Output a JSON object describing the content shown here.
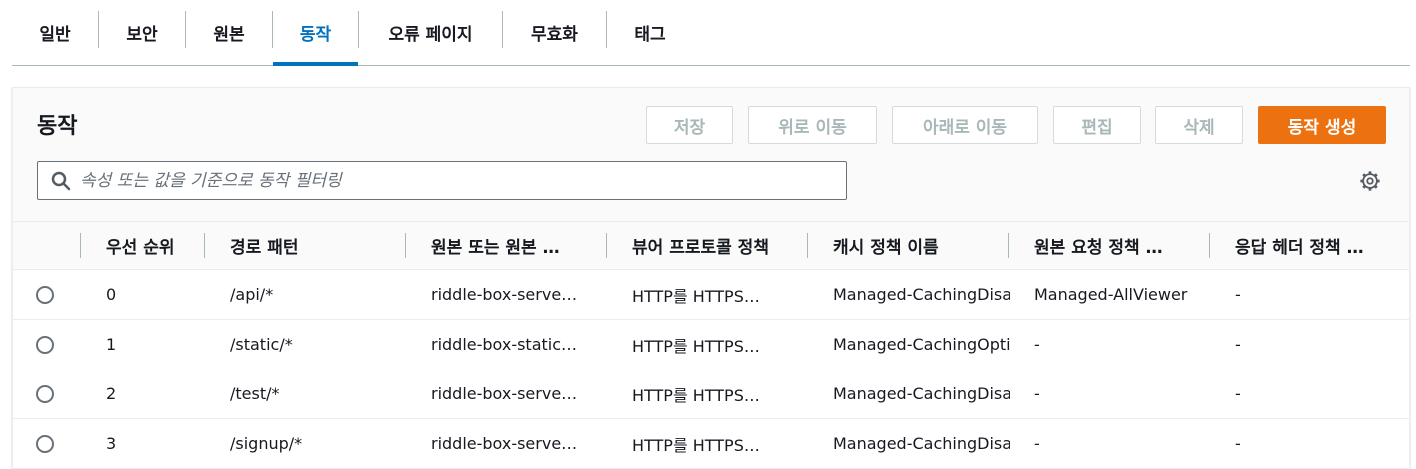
{
  "tabs": [
    {
      "label": "일반"
    },
    {
      "label": "보안"
    },
    {
      "label": "원본"
    },
    {
      "label": "동작"
    },
    {
      "label": "오류 페이지"
    },
    {
      "label": "무효화"
    },
    {
      "label": "태그"
    }
  ],
  "active_tab": "동작",
  "panel": {
    "title": "동작",
    "buttons": {
      "save": "저장",
      "move_up": "위로 이동",
      "move_down": "아래로 이동",
      "edit": "편집",
      "delete": "삭제",
      "create": "동작 생성"
    },
    "search_placeholder": "속성 또는 값을 기준으로 동작 필터링"
  },
  "table": {
    "columns": [
      "우선 순위",
      "경로 패턴",
      "원본 또는 원본 …",
      "뷰어 프로토콜 정책",
      "캐시 정책 이름",
      "원본 요청 정책 …",
      "응답 헤더 정책 …"
    ],
    "rows": [
      {
        "priority": "0",
        "path": "/api/*",
        "origin": "riddle-box-serve…",
        "viewer": "HTTP를 HTTPS…",
        "cache": "Managed-CachingDisa",
        "origin_request": "Managed-AllViewer",
        "response_headers": "-"
      },
      {
        "priority": "1",
        "path": "/static/*",
        "origin": "riddle-box-static…",
        "viewer": "HTTP를 HTTPS…",
        "cache": "Managed-CachingOpti",
        "origin_request": "-",
        "response_headers": "-"
      },
      {
        "priority": "2",
        "path": "/test/*",
        "origin": "riddle-box-serve…",
        "viewer": "HTTP를 HTTPS…",
        "cache": "Managed-CachingDisa",
        "origin_request": "-",
        "response_headers": "-"
      },
      {
        "priority": "3",
        "path": "/signup/*",
        "origin": "riddle-box-serve…",
        "viewer": "HTTP를 HTTPS…",
        "cache": "Managed-CachingDisa",
        "origin_request": "-",
        "response_headers": "-"
      }
    ]
  },
  "colors": {
    "accent": "#0073bb",
    "primary_button": "#ec7211",
    "disabled_text": "#aab7b8"
  }
}
